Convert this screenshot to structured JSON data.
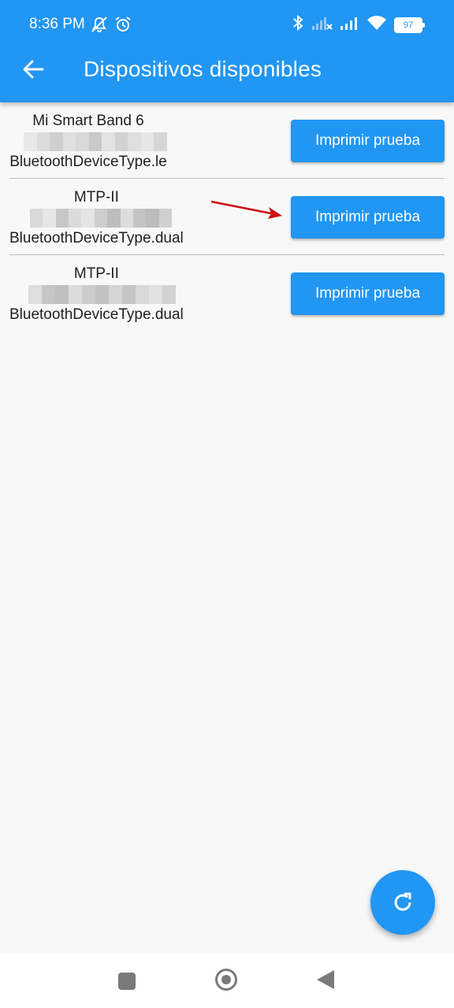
{
  "status_bar": {
    "time": "8:36 PM",
    "battery": "97",
    "icons": [
      "mute-icon",
      "alarm-icon",
      "bluetooth-icon",
      "signal-off-icon",
      "signal-icon",
      "wifi-icon",
      "battery-icon"
    ]
  },
  "app_bar": {
    "title": "Dispositivos disponibles",
    "back_icon": "arrow-back-icon",
    "color": "#2196f3"
  },
  "devices": [
    {
      "name": "Mi Smart Band 6",
      "type": "BluetoothDeviceType.le",
      "button_label": "Imprimir prueba"
    },
    {
      "name": "MTP-II",
      "type": "BluetoothDeviceType.dual",
      "button_label": "Imprimir prueba"
    },
    {
      "name": "MTP-II",
      "type": "BluetoothDeviceType.dual",
      "button_label": "Imprimir prueba"
    }
  ],
  "fab": {
    "icon": "refresh-icon"
  },
  "annotation": {
    "color": "#cc1111"
  },
  "nav_bar": {
    "icons": [
      "recent-apps-icon",
      "home-icon",
      "back-triangle-icon"
    ]
  }
}
